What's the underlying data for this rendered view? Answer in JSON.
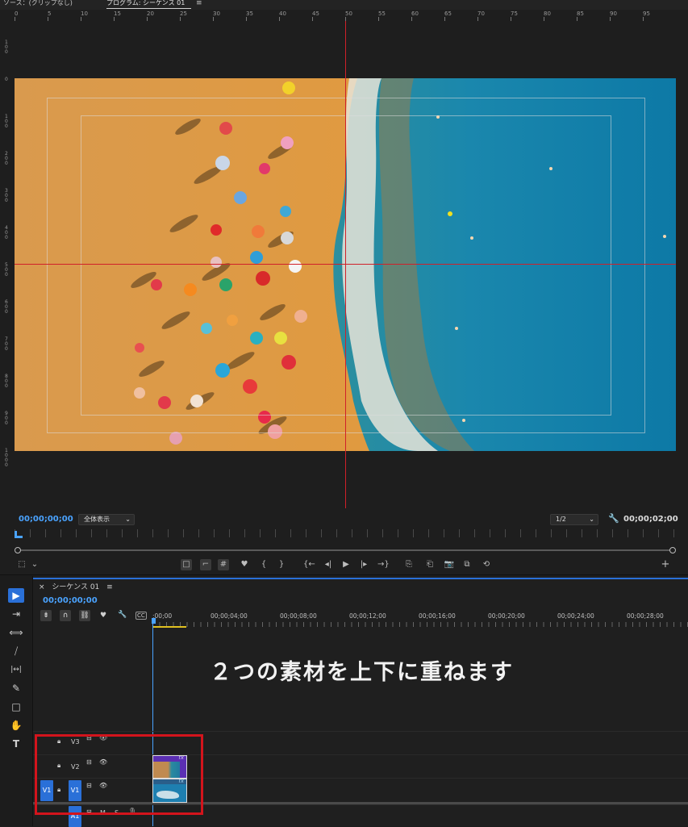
{
  "tabs": {
    "source": "ソース：(クリップなし)",
    "program": "プログラム: シーケンス 01",
    "menu_glyph": "≡"
  },
  "ruler": {
    "top_labels": [
      "0",
      "5",
      "10",
      "15",
      "20",
      "25",
      "30",
      "35",
      "40",
      "45",
      "50",
      "55",
      "60",
      "65",
      "70",
      "75",
      "80",
      "85",
      "90",
      "95"
    ],
    "left_labels": [
      "100",
      "0",
      "100",
      "200",
      "300",
      "400",
      "500",
      "600",
      "700",
      "800",
      "900",
      "1000"
    ]
  },
  "monitor": {
    "timecode_current": "00;00;00;00",
    "zoom": "全体表示",
    "resolution": "1/2",
    "timecode_duration": "00;00;02;00",
    "controls": [
      "□",
      "⌐",
      "#",
      "♥",
      "{",
      "}",
      "{←",
      "◂|",
      "▶",
      "|▸",
      "→}",
      "⎘",
      "⎗",
      "📷",
      "⧉",
      "⟲"
    ],
    "add": "+"
  },
  "tools": [
    "▶",
    "⇥",
    "⟺",
    "⧸",
    "|↔|",
    "✎",
    "□",
    "✋",
    "T"
  ],
  "timeline": {
    "sequence_name": "シーケンス 01",
    "close": "×",
    "menu_glyph": "≡",
    "timecode": "00;00;00;00",
    "ticks": [
      ";00;00",
      "00;00;04;00",
      "00;00;08;00",
      "00;00;12;00",
      "00;00;16;00",
      "00;00;20;00",
      "00;00;24;00",
      "00;00;28;00"
    ],
    "caption": "２つの素材を上下に重ねます",
    "tracks": [
      {
        "name": "V3"
      },
      {
        "name": "V2"
      },
      {
        "name": "V1",
        "source": "V1"
      },
      {
        "name": "A1",
        "mute": "M",
        "solo": "S"
      }
    ],
    "clip_fx": "fx"
  },
  "colors": {
    "accent_blue": "#4aa3ff",
    "highlight_red": "#d3141c",
    "clip_purple": "#5b2fb3"
  }
}
